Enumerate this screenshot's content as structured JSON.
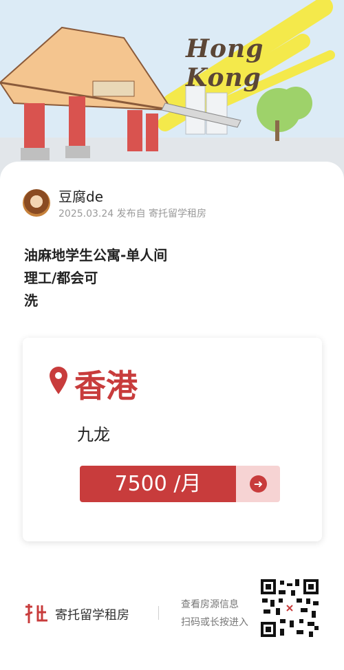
{
  "hero": {
    "title": "Hong Kong"
  },
  "author": {
    "name": "豆腐de",
    "meta": "2025.03.24 发布自 寄托留学租房"
  },
  "post": {
    "title": "油麻地学生公寓-单人间\n理工/都会可\n洗"
  },
  "listing": {
    "city": "香港",
    "district": "九龙",
    "price_label": "7500 /月",
    "icons": {
      "location": "location-pin-icon",
      "arrow": "arrow-right-icon"
    }
  },
  "footer": {
    "brand": "寄托留学租房",
    "qr_line1": "查看房源信息",
    "qr_line2": "扫码或长按进入"
  },
  "colors": {
    "accent": "#c83c3c",
    "accent_light": "#f6d3d3"
  }
}
